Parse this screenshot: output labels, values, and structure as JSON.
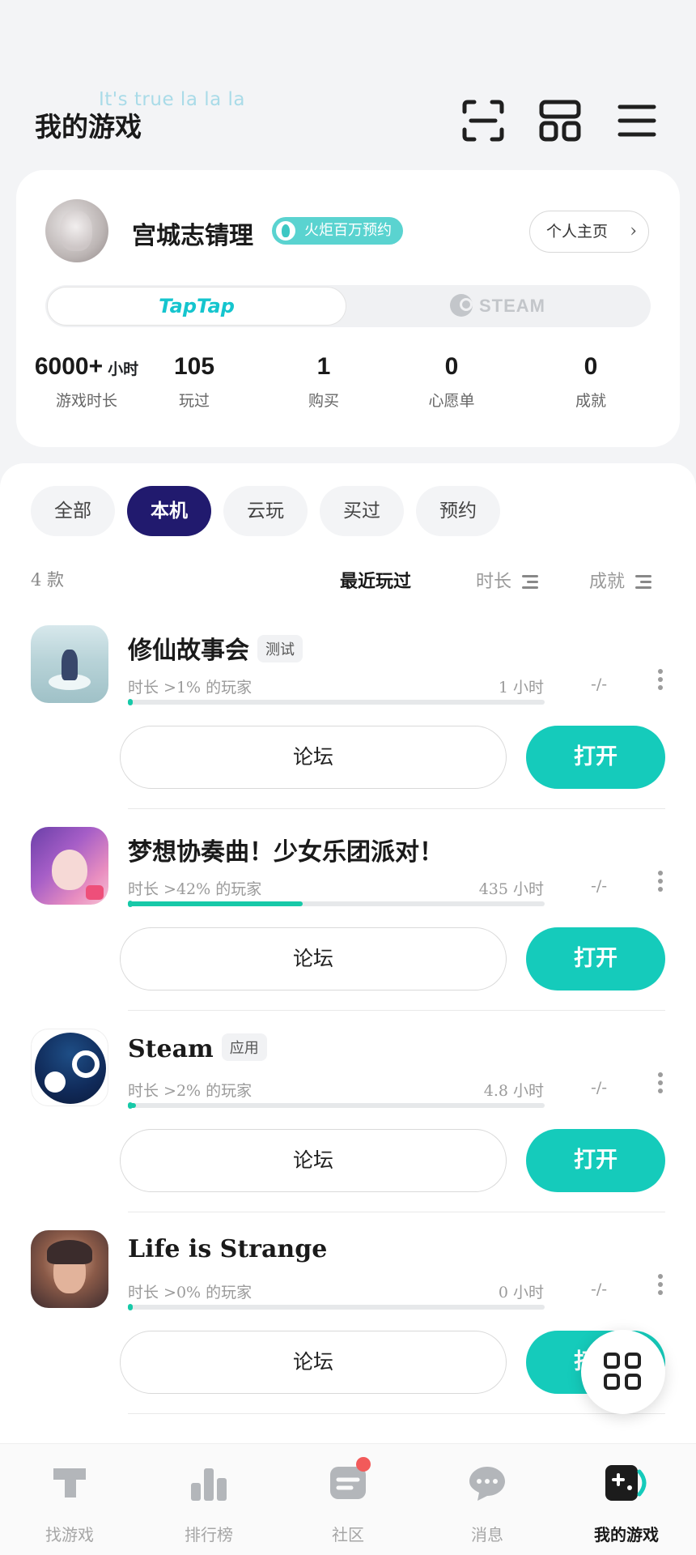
{
  "header": {
    "watermark": "It's true la la la",
    "title": "我的游戏",
    "icons": [
      "scan-icon",
      "grid-layout-icon",
      "menu-icon"
    ]
  },
  "profile": {
    "username": "宫城志锖理",
    "badge": "火炬百万预约",
    "home_button": "个人主页",
    "platforms": {
      "taptap": "TapTap",
      "steam": "STEAM",
      "selected": "TapTap"
    },
    "stats": [
      {
        "value": "6000+",
        "unit": "小时",
        "label": "游戏时长"
      },
      {
        "value": "105",
        "label": "玩过"
      },
      {
        "value": "1",
        "label": "购买"
      },
      {
        "value": "0",
        "label": "心愿单"
      },
      {
        "value": "0",
        "label": "成就"
      }
    ]
  },
  "filters": {
    "chips": [
      "全部",
      "本机",
      "云玩",
      "买过",
      "预约"
    ],
    "active": "本机"
  },
  "list": {
    "count": "4 款",
    "sort": {
      "recent": "最近玩过",
      "duration": "时长",
      "achievement": "成就"
    },
    "games": [
      {
        "name": "修仙故事会",
        "tag": "测试",
        "sub": "时长 >1% 的玩家",
        "time": "1 小时",
        "ach": "-/-",
        "progress": 0.01,
        "forum": "论坛",
        "open": "打开"
      },
      {
        "name": "梦想协奏曲！少女乐团派对！",
        "tag": "",
        "sub": "时长 >42% 的玩家",
        "time": "435 小时",
        "ach": "-/-",
        "progress": 0.42,
        "forum": "论坛",
        "open": "打开"
      },
      {
        "name": "Steam",
        "tag": "应用",
        "sub": "时长 >2% 的玩家",
        "time": "4.8 小时",
        "ach": "-/-",
        "progress": 0.02,
        "forum": "论坛",
        "open": "打开"
      },
      {
        "name": "Life is Strange",
        "tag": "",
        "sub": "时长 >0% 的玩家",
        "time": "0 小时",
        "ach": "-/-",
        "progress": 0.0,
        "forum": "论坛",
        "open": "打开"
      }
    ]
  },
  "bottom_nav": [
    {
      "label": "找游戏",
      "icon": "taptap-icon"
    },
    {
      "label": "排行榜",
      "icon": "ranking-icon"
    },
    {
      "label": "社区",
      "icon": "community-icon",
      "dot": true
    },
    {
      "label": "消息",
      "icon": "message-icon"
    },
    {
      "label": "我的游戏",
      "icon": "gamepad-icon",
      "active": true
    }
  ],
  "colors": {
    "accent": "#15cbbb",
    "chip_active": "#211a6e",
    "progress": "#17c9a8",
    "badge": "#5ad3d0"
  }
}
